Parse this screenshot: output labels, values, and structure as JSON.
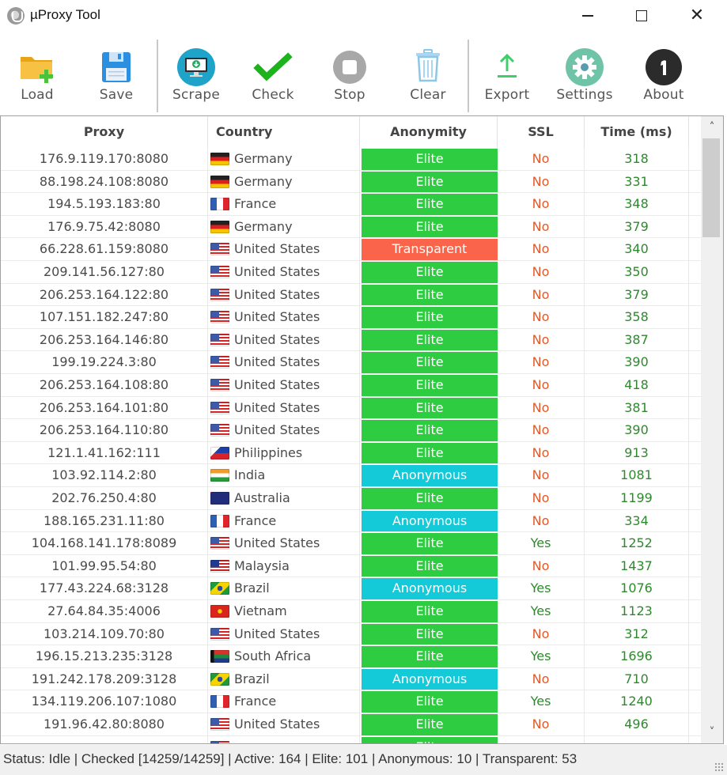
{
  "window": {
    "title": "µProxy Tool",
    "minimize": "minimize",
    "maximize": "maximize",
    "close": "✕"
  },
  "toolbar": [
    {
      "id": "load",
      "label": "Load",
      "icon": "folder-add-icon"
    },
    {
      "id": "save",
      "label": "Save",
      "icon": "floppy-disk-icon"
    },
    {
      "id": "scrape",
      "label": "Scrape",
      "icon": "monitor-download-icon"
    },
    {
      "id": "check",
      "label": "Check",
      "icon": "checkmark-icon"
    },
    {
      "id": "stop",
      "label": "Stop",
      "icon": "stop-icon"
    },
    {
      "id": "clear",
      "label": "Clear",
      "icon": "trash-icon"
    },
    {
      "id": "export",
      "label": "Export",
      "icon": "upload-icon"
    },
    {
      "id": "settings",
      "label": "Settings",
      "icon": "gear-icon"
    },
    {
      "id": "about",
      "label": "About",
      "icon": "info-icon"
    }
  ],
  "grid": {
    "columns": [
      "Proxy",
      "Country",
      "Anonymity",
      "SSL",
      "Time (ms)"
    ],
    "anonymity_colors": {
      "Elite": "#2ecc40",
      "Anonymous": "#14c9d8",
      "Transparent": "#f9644a"
    },
    "rows": [
      {
        "proxy": "176.9.119.170:8080",
        "country": "Germany",
        "flag": "de",
        "anonymity": "Elite",
        "ssl": "No",
        "time": "318"
      },
      {
        "proxy": "88.198.24.108:8080",
        "country": "Germany",
        "flag": "de",
        "anonymity": "Elite",
        "ssl": "No",
        "time": "331"
      },
      {
        "proxy": "194.5.193.183:80",
        "country": "France",
        "flag": "fr",
        "anonymity": "Elite",
        "ssl": "No",
        "time": "348"
      },
      {
        "proxy": "176.9.75.42:8080",
        "country": "Germany",
        "flag": "de",
        "anonymity": "Elite",
        "ssl": "No",
        "time": "379"
      },
      {
        "proxy": "66.228.61.159:8080",
        "country": "United States",
        "flag": "us",
        "anonymity": "Transparent",
        "ssl": "No",
        "time": "340"
      },
      {
        "proxy": "209.141.56.127:80",
        "country": "United States",
        "flag": "us",
        "anonymity": "Elite",
        "ssl": "No",
        "time": "350"
      },
      {
        "proxy": "206.253.164.122:80",
        "country": "United States",
        "flag": "us",
        "anonymity": "Elite",
        "ssl": "No",
        "time": "379"
      },
      {
        "proxy": "107.151.182.247:80",
        "country": "United States",
        "flag": "us",
        "anonymity": "Elite",
        "ssl": "No",
        "time": "358"
      },
      {
        "proxy": "206.253.164.146:80",
        "country": "United States",
        "flag": "us",
        "anonymity": "Elite",
        "ssl": "No",
        "time": "387"
      },
      {
        "proxy": "199.19.224.3:80",
        "country": "United States",
        "flag": "us",
        "anonymity": "Elite",
        "ssl": "No",
        "time": "390"
      },
      {
        "proxy": "206.253.164.108:80",
        "country": "United States",
        "flag": "us",
        "anonymity": "Elite",
        "ssl": "No",
        "time": "418"
      },
      {
        "proxy": "206.253.164.101:80",
        "country": "United States",
        "flag": "us",
        "anonymity": "Elite",
        "ssl": "No",
        "time": "381"
      },
      {
        "proxy": "206.253.164.110:80",
        "country": "United States",
        "flag": "us",
        "anonymity": "Elite",
        "ssl": "No",
        "time": "390"
      },
      {
        "proxy": "121.1.41.162:111",
        "country": "Philippines",
        "flag": "ph",
        "anonymity": "Elite",
        "ssl": "No",
        "time": "913"
      },
      {
        "proxy": "103.92.114.2:80",
        "country": "India",
        "flag": "in",
        "anonymity": "Anonymous",
        "ssl": "No",
        "time": "1081"
      },
      {
        "proxy": "202.76.250.4:80",
        "country": "Australia",
        "flag": "au",
        "anonymity": "Elite",
        "ssl": "No",
        "time": "1199"
      },
      {
        "proxy": "188.165.231.11:80",
        "country": "France",
        "flag": "fr",
        "anonymity": "Anonymous",
        "ssl": "No",
        "time": "334"
      },
      {
        "proxy": "104.168.141.178:8089",
        "country": "United States",
        "flag": "us",
        "anonymity": "Elite",
        "ssl": "Yes",
        "time": "1252"
      },
      {
        "proxy": "101.99.95.54:80",
        "country": "Malaysia",
        "flag": "my",
        "anonymity": "Elite",
        "ssl": "No",
        "time": "1437"
      },
      {
        "proxy": "177.43.224.68:3128",
        "country": "Brazil",
        "flag": "br",
        "anonymity": "Anonymous",
        "ssl": "Yes",
        "time": "1076"
      },
      {
        "proxy": "27.64.84.35:4006",
        "country": "Vietnam",
        "flag": "vn",
        "anonymity": "Elite",
        "ssl": "Yes",
        "time": "1123"
      },
      {
        "proxy": "103.214.109.70:80",
        "country": "United States",
        "flag": "us",
        "anonymity": "Elite",
        "ssl": "No",
        "time": "312"
      },
      {
        "proxy": "196.15.213.235:3128",
        "country": "South Africa",
        "flag": "za",
        "anonymity": "Elite",
        "ssl": "Yes",
        "time": "1696"
      },
      {
        "proxy": "191.242.178.209:3128",
        "country": "Brazil",
        "flag": "br",
        "anonymity": "Anonymous",
        "ssl": "No",
        "time": "710"
      },
      {
        "proxy": "134.119.206.107:1080",
        "country": "France",
        "flag": "fr",
        "anonymity": "Elite",
        "ssl": "Yes",
        "time": "1240"
      },
      {
        "proxy": "191.96.42.80:8080",
        "country": "United States",
        "flag": "us",
        "anonymity": "Elite",
        "ssl": "No",
        "time": "496"
      },
      {
        "proxy": "",
        "country": "",
        "flag": "us",
        "anonymity": "Elite",
        "ssl": "",
        "time": ""
      }
    ]
  },
  "scrollbar": {
    "position_fraction": 0.0,
    "visible_fraction": 0.17
  },
  "status": {
    "text": "Status: Idle | Checked [14259/14259] | Active: 164 | Elite: 101 | Anonymous: 10 | Transparent: 53"
  }
}
